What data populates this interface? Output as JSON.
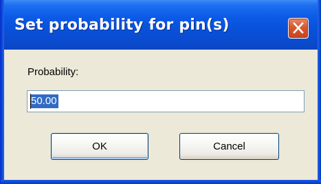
{
  "window": {
    "title": "Set probability for pin(s)",
    "close_icon": "close-icon"
  },
  "form": {
    "probability_label": "Probability:",
    "probability_value": "50.00"
  },
  "buttons": {
    "ok_label": "OK",
    "cancel_label": "Cancel"
  },
  "colors": {
    "titlebar": "#0851d9",
    "dialog_background": "#ece9d8",
    "close_button": "#d8582f",
    "selection": "#316ac5"
  }
}
